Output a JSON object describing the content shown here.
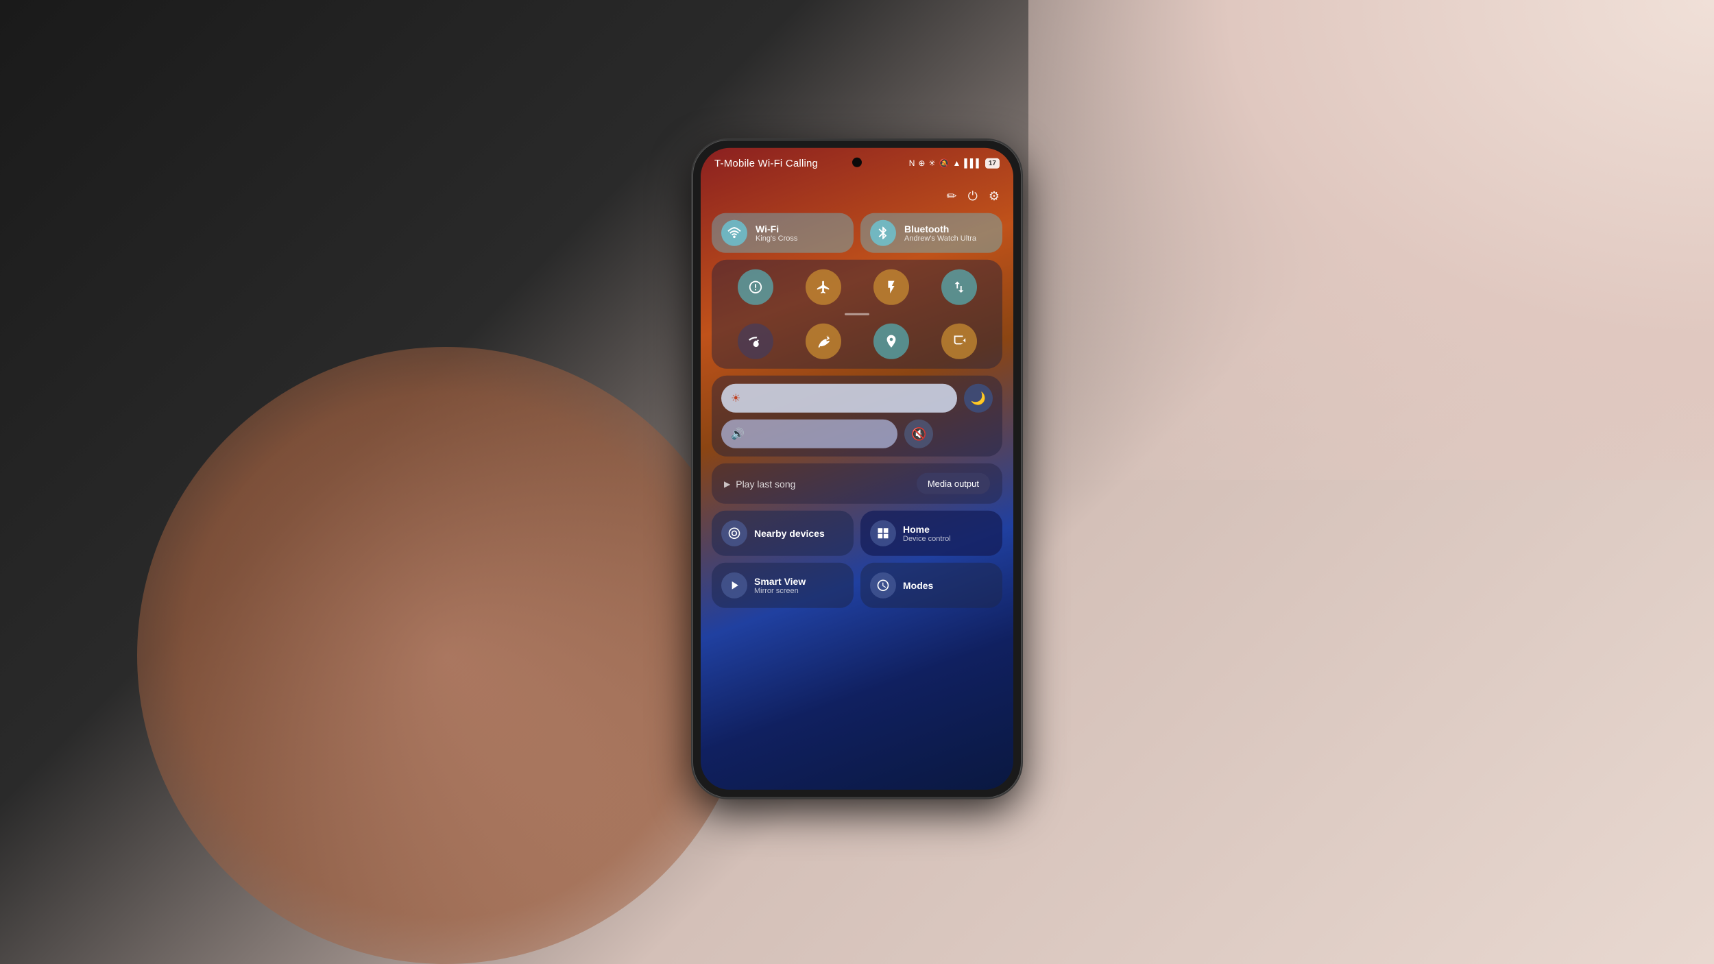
{
  "background": {
    "description": "Hand holding phone against table background"
  },
  "status_bar": {
    "carrier": "T-Mobile Wi-Fi Calling",
    "icons": [
      "NFC",
      "bluetooth",
      "mute",
      "signal",
      "bars",
      "battery"
    ],
    "battery_level": "17"
  },
  "edit_row": {
    "pencil_label": "✏",
    "power_label": "⏻",
    "settings_label": "⚙"
  },
  "quick_toggles": {
    "wifi": {
      "icon": "📶",
      "label": "Wi-Fi",
      "sublabel": "King's Cross"
    },
    "bluetooth": {
      "icon": "🔵",
      "label": "Bluetooth",
      "sublabel": "Andrew's Watch Ultra"
    }
  },
  "grid_buttons": {
    "row1": [
      {
        "icon": "◎",
        "style": "teal",
        "name": "auto-rotate"
      },
      {
        "icon": "✈",
        "style": "orange",
        "name": "airplane-mode"
      },
      {
        "icon": "🔦",
        "style": "orange",
        "name": "flashlight"
      },
      {
        "icon": "↕",
        "style": "teal",
        "name": "mobile-data"
      }
    ],
    "row2": [
      {
        "icon": "📡",
        "style": "dark",
        "name": "hotspot"
      },
      {
        "icon": "🍃",
        "style": "orange",
        "name": "power-save"
      },
      {
        "icon": "📍",
        "style": "teal",
        "name": "location"
      },
      {
        "icon": "📋",
        "style": "orange",
        "name": "screen-record"
      }
    ]
  },
  "sliders": {
    "brightness": {
      "icon": "☀",
      "side_icon": "🌙"
    },
    "volume": {
      "icon": "🔊",
      "side_icon": "🔇"
    }
  },
  "media": {
    "play_label": "Play last song",
    "play_icon": "▶",
    "output_label": "Media output"
  },
  "tiles": {
    "nearby_devices": {
      "icon": "📡",
      "label": "Nearby devices",
      "sublabel": ""
    },
    "home": {
      "icon": "⊞",
      "label": "Home",
      "sublabel": "Device control"
    },
    "smart_view": {
      "icon": "▷",
      "label": "Smart View",
      "sublabel": "Mirror screen"
    },
    "modes": {
      "icon": "⏱",
      "label": "Modes",
      "sublabel": ""
    }
  }
}
